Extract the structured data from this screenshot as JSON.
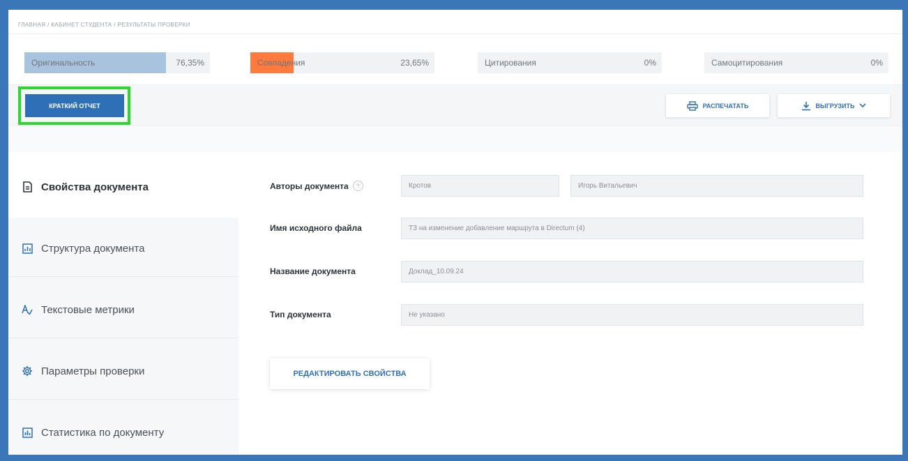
{
  "breadcrumb": "ГЛАВНАЯ / КАБИНЕТ СТУДЕНТА / РЕЗУЛЬТАТЫ ПРОВЕРКИ",
  "metrics": [
    {
      "label": "Оригинальность",
      "value": "76,35%",
      "fill_fraction": 0.7635,
      "color": "#a8c3de"
    },
    {
      "label": "Совпадения",
      "value": "23,65%",
      "fill_fraction": 0.2365,
      "color": "#ff7a3d"
    },
    {
      "label": "Цитирования",
      "value": "0%",
      "fill_fraction": 0,
      "color": "#a8c3de"
    },
    {
      "label": "Самоцитирования",
      "value": "0%",
      "fill_fraction": 0,
      "color": "#a8c3de"
    }
  ],
  "toolbar": {
    "short_report": "КРАТКИЙ ОТЧЕТ",
    "print": "РАСПЕЧАТАТЬ",
    "export": "ВЫГРУЗИТЬ"
  },
  "sidebar": {
    "items": [
      {
        "label": "Свойства документа",
        "icon": "document-icon",
        "active": true
      },
      {
        "label": "Структура документа",
        "icon": "structure-icon",
        "active": false
      },
      {
        "label": "Текстовые метрики",
        "icon": "text-metrics-icon",
        "active": false
      },
      {
        "label": "Параметры проверки",
        "icon": "gear-icon",
        "active": false
      },
      {
        "label": "Статистика по документу",
        "icon": "bar-chart-icon",
        "active": false
      }
    ]
  },
  "form": {
    "authors_label": "Авторы документа",
    "author_last_name": "Кротов",
    "author_first_name": "Игорь Витальевич",
    "filename_label": "Имя исходного файла",
    "filename_value": "ТЗ на изменение добавление маршрута в Directum (4)",
    "title_label": "Название документа",
    "title_value": "Доклад_10.09.24",
    "type_label": "Тип документа",
    "type_value": "Не указано",
    "help_glyph": "?",
    "edit_button": "РЕДАКТИРОВАТЬ СВОЙСТВА"
  },
  "colors": {
    "accent": "#2f6fb5",
    "highlight": "#2bd82b",
    "frame": "#3a76b8"
  }
}
